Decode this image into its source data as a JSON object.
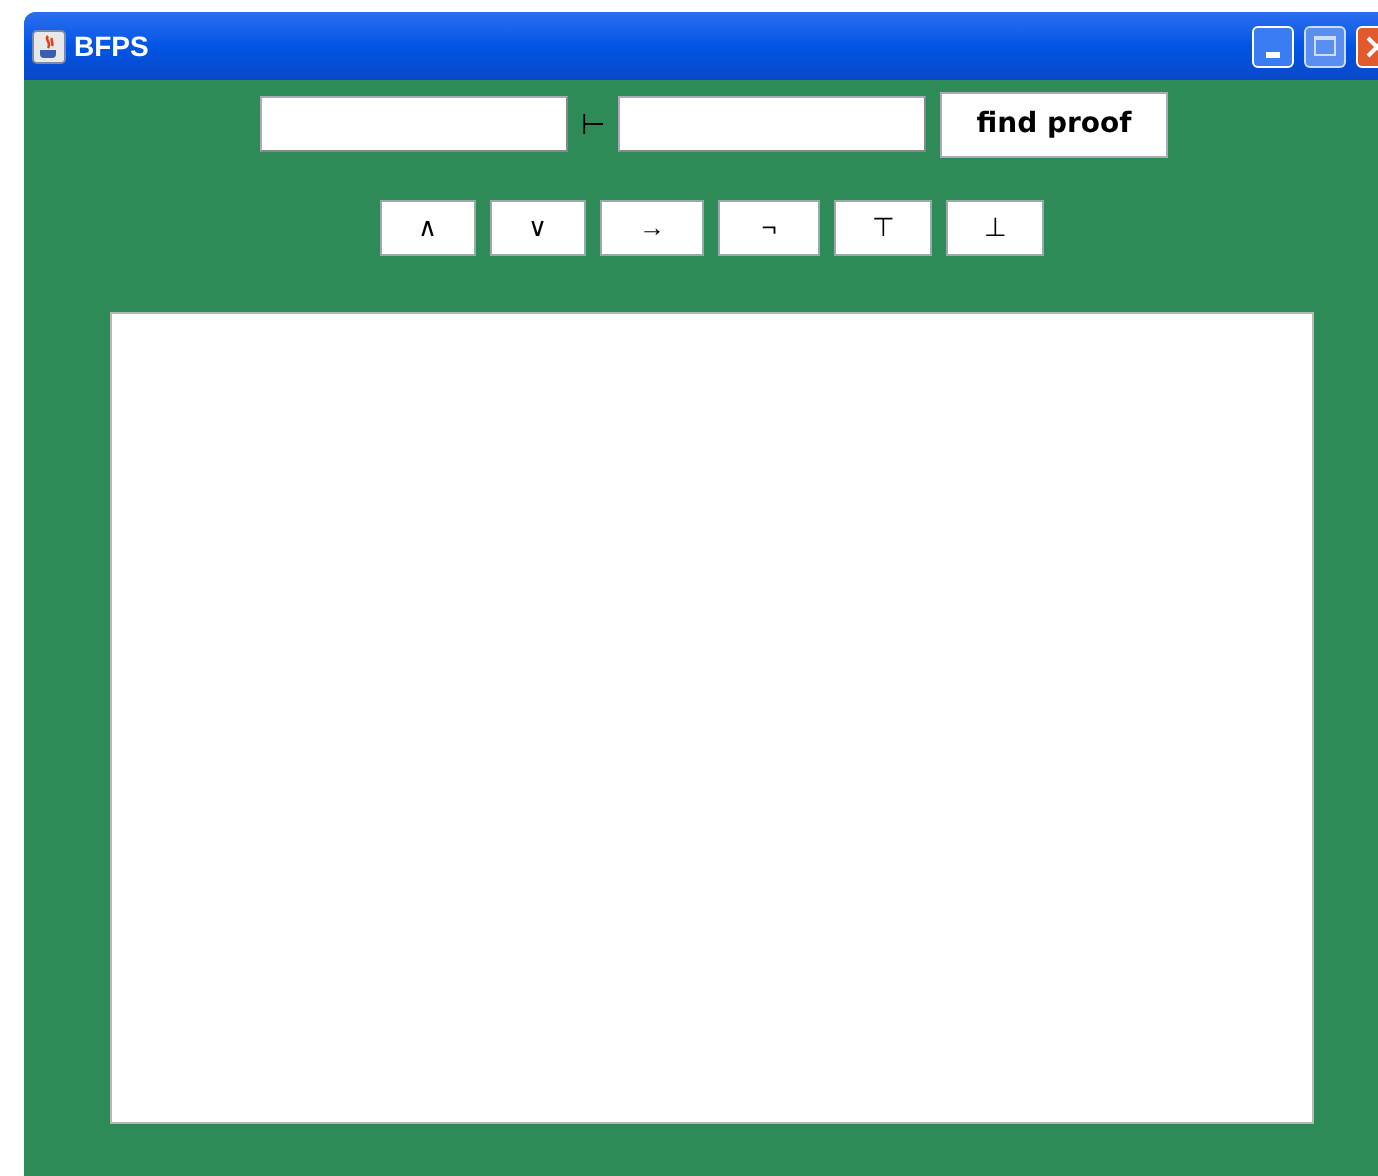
{
  "window": {
    "title": "BFPS"
  },
  "query": {
    "turnstile": "⊢",
    "find_button": "find proof"
  },
  "symbols": [
    "∧",
    "∨",
    "→",
    "¬",
    "⊤",
    "⊥"
  ]
}
